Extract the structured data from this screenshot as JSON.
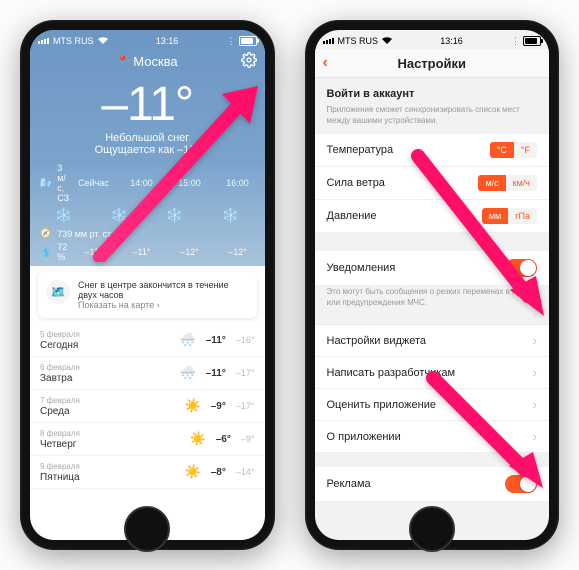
{
  "accent": "#ff5722",
  "left": {
    "status": {
      "carrier": "MTS RUS",
      "time": "13:16"
    },
    "city": "Москва",
    "temp": "–11°",
    "condition": "Небольшой снег",
    "feels": "Ощущается как –17°",
    "wind": "3 м/с, СЗ",
    "pressure": "739 мм рт. ст.",
    "humidity": "72 %",
    "now_label": "Сейчас",
    "hourly": [
      {
        "label": "Сейчас",
        "icon": "❄️",
        "t": "–11°"
      },
      {
        "label": "14:00",
        "icon": "❄️",
        "t": "–11°"
      },
      {
        "label": "15:00",
        "icon": "❄️",
        "t": "–12°"
      },
      {
        "label": "16:00",
        "icon": "❄️",
        "t": "–12°"
      }
    ],
    "card_title": "Снег в центре закончится в течение двух часов",
    "card_link": "Показать на карте",
    "daily": [
      {
        "date": "5 февраля",
        "day": "Сегодня",
        "icon": "🌨️",
        "hi": "–11°",
        "lo": "–16°"
      },
      {
        "date": "6 февраля",
        "day": "Завтра",
        "icon": "🌨️",
        "hi": "–11°",
        "lo": "–17°"
      },
      {
        "date": "7 февраля",
        "day": "Среда",
        "icon": "☀️",
        "hi": "–9°",
        "lo": "–17°"
      },
      {
        "date": "8 февраля",
        "day": "Четверг",
        "icon": "☀️",
        "hi": "–6°",
        "lo": "–9°"
      },
      {
        "date": "9 февраля",
        "day": "Пятница",
        "icon": "☀️",
        "hi": "–8°",
        "lo": "–14°"
      }
    ]
  },
  "right": {
    "status": {
      "carrier": "MTS RUS",
      "time": "13:16"
    },
    "title": "Настройки",
    "account": {
      "header": "Войти в аккаунт",
      "sub": "Приложение сможет синхронизировать список мест между вашими устройствами."
    },
    "units": {
      "temperature": {
        "label": "Температура",
        "opts": [
          "°C",
          "°F"
        ],
        "sel": 0
      },
      "wind": {
        "label": "Сила ветра",
        "opts": [
          "м/с",
          "км/ч"
        ],
        "sel": 0
      },
      "pressure": {
        "label": "Давление",
        "opts": [
          "мм",
          "гПа"
        ],
        "sel": 0
      }
    },
    "notifications": {
      "label": "Уведомления",
      "sub": "Это могут быть сообщения о резких переменах в погоде или предупреждения МЧС."
    },
    "rows": [
      "Настройки виджета",
      "Написать разработчикам",
      "Оценить приложение",
      "О приложении"
    ],
    "ads": "Реклама"
  }
}
